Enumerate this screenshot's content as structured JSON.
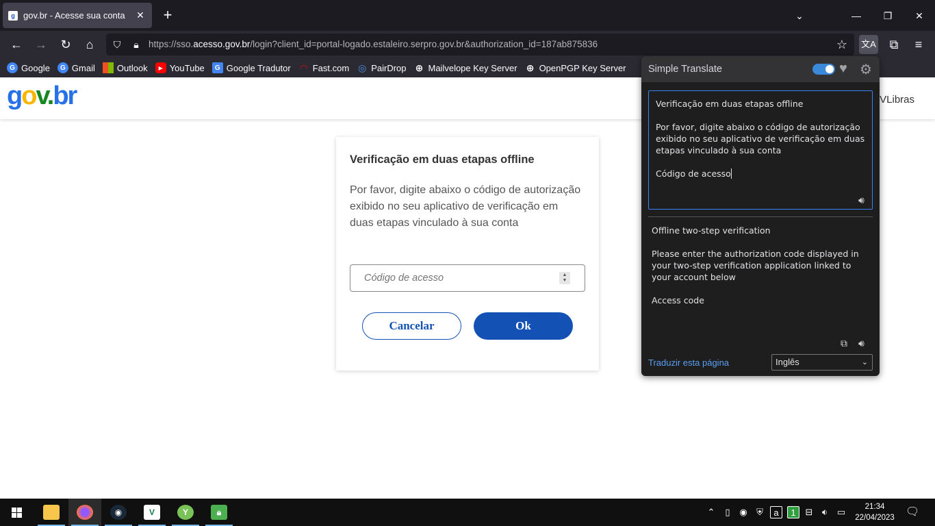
{
  "browser": {
    "tab_title": "gov.br - Acesse sua conta",
    "url_prefix": "https://sso.",
    "url_host": "acesso.gov.br",
    "url_rest": "/login?client_id=portal-logado.estaleiro.serpro.gov.br&authorization_id=187ab875836",
    "bookmarks": [
      {
        "label": "Google",
        "icon": "google-icon",
        "color": "#4285f4"
      },
      {
        "label": "Gmail",
        "icon": "google-icon",
        "color": "#4285f4"
      },
      {
        "label": "Outlook",
        "icon": "microsoft-icon",
        "color": "#f25022"
      },
      {
        "label": "YouTube",
        "icon": "youtube-icon",
        "color": "#ff0000"
      },
      {
        "label": "Google Tradutor",
        "icon": "translate-icon",
        "color": "#4285f4"
      },
      {
        "label": "Fast.com",
        "icon": "fast-icon",
        "color": "#e50914"
      },
      {
        "label": "PairDrop",
        "icon": "pairdrop-icon",
        "color": "#4a90e2"
      },
      {
        "label": "Mailvelope Key Server",
        "icon": "globe-icon",
        "color": "#2b2a33"
      },
      {
        "label": "OpenPGP Key Server",
        "icon": "globe-icon",
        "color": "#2b2a33"
      }
    ]
  },
  "page": {
    "vlibras": "VLibras",
    "card": {
      "title": "Verificação em duas etapas offline",
      "description": "Por favor, digite abaixo o código de autorização exibido no seu aplicativo de verificação em duas etapas vinculado à sua conta",
      "input_placeholder": "Código de acesso",
      "cancel_label": "Cancelar",
      "ok_label": "Ok"
    }
  },
  "simple_translate": {
    "title": "Simple Translate",
    "source": {
      "line1": "Verificação em duas etapas offline",
      "line2": "Por favor, digite abaixo o código de autorização exibido no seu aplicativo de verificação em duas etapas vinculado à sua conta",
      "line3": "Código de acesso"
    },
    "result": {
      "line1": "Offline two-step verification",
      "line2": "Please enter the authorization code displayed in your two-step verification application linked to your account below",
      "line3": "Access code"
    },
    "translate_page_link": "Traduzir esta página",
    "target_language": "Inglês"
  },
  "taskbar": {
    "time": "21:34",
    "date": "22/04/2023"
  }
}
